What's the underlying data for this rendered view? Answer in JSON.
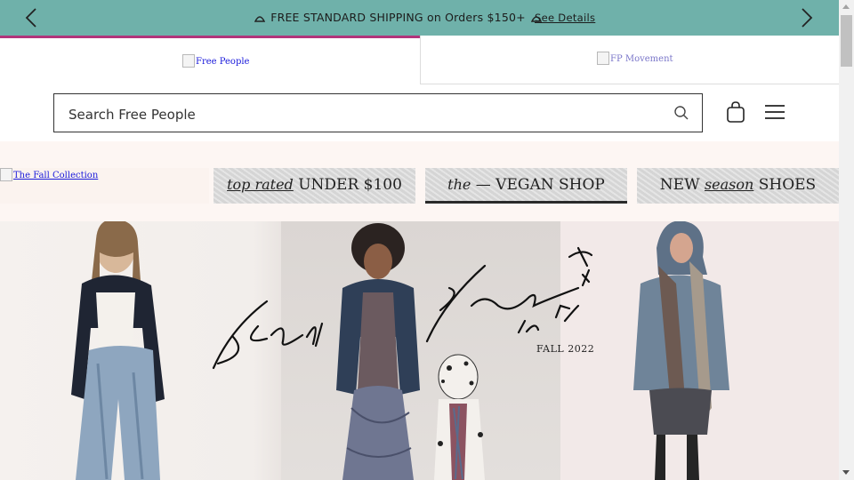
{
  "promo_bar": {
    "message": "FREE STANDARD SHIPPING on Orders $150+",
    "details_link": "See Details",
    "prev_icon": "chevron-left-icon",
    "next_icon": "chevron-right-icon",
    "background": "#6fb1aa"
  },
  "brand_tabs": [
    {
      "alt": "Free People",
      "active": true,
      "accent": "#b2347b"
    },
    {
      "alt": "FP Movement",
      "active": false
    }
  ],
  "search": {
    "placeholder": "Search Free People",
    "value": "",
    "icon": "search-icon"
  },
  "header_icons": {
    "bag": "shopping-bag-icon",
    "menu": "hamburger-menu-icon"
  },
  "promo_tiles": [
    {
      "alt": "The Fall Collection",
      "broken_image": true
    },
    {
      "italic": "top rated",
      "text": "UNDER $100"
    },
    {
      "italic": "the",
      "dash": "—",
      "text": "VEGAN SHOP"
    },
    {
      "text_pre": "NEW",
      "italic": "season",
      "text": "SHOES"
    }
  ],
  "hero": {
    "script_headline": "Feel Free in FP",
    "season": "FALL 2022"
  }
}
